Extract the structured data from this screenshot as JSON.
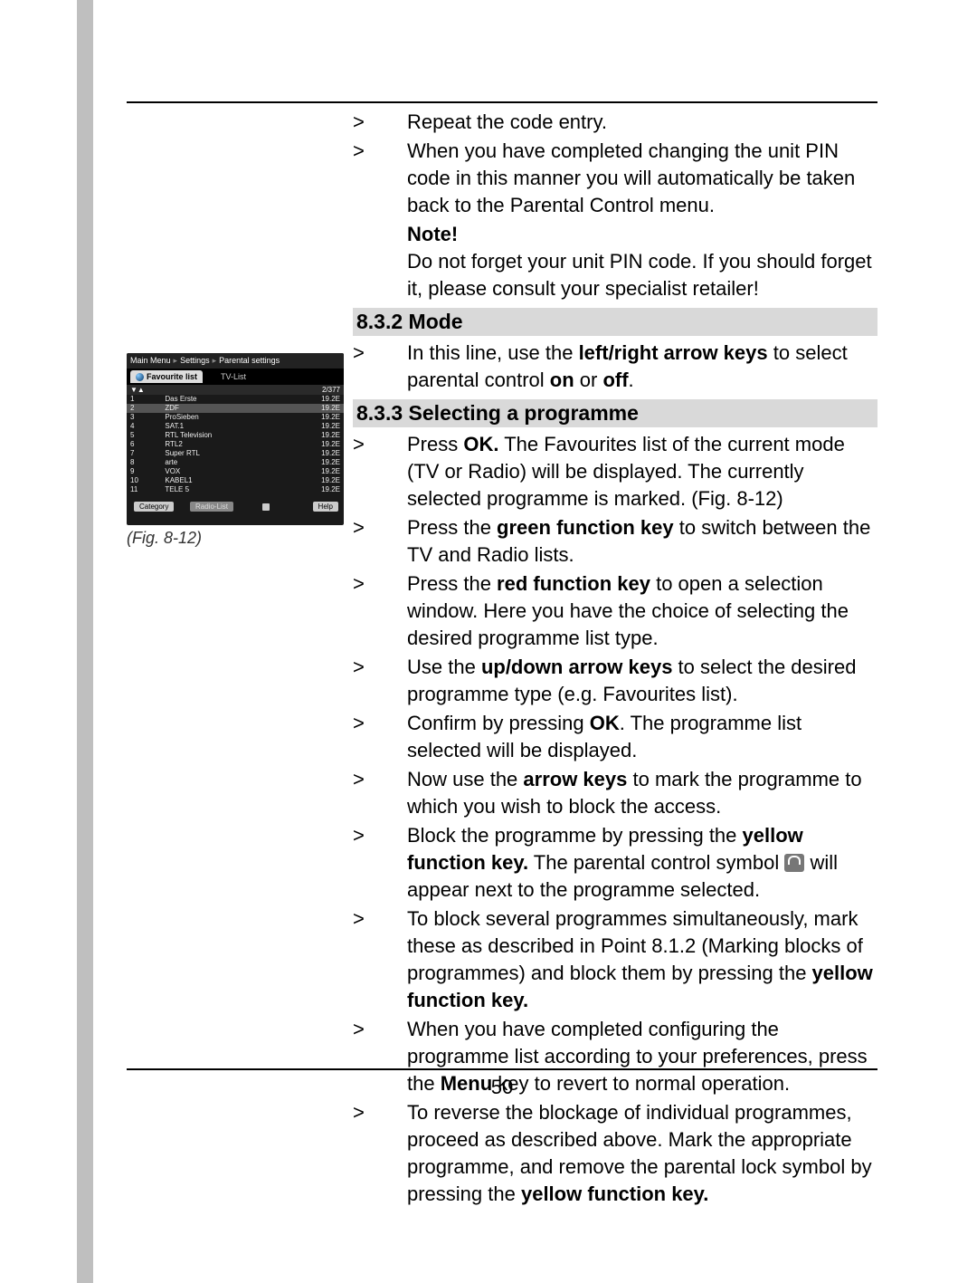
{
  "page_number": "50",
  "intro_steps": [
    "Repeat the code entry.",
    "When you have completed changing the unit PIN code in this manner you will automatically be taken back to the Parental Control menu."
  ],
  "note_label": "Note!",
  "note_text": "Do not forget your unit PIN code. If you should forget it, please consult your specialist retailer!",
  "sect_mode": "8.3.2 Mode",
  "mode_step_pre": "In this line, use the ",
  "mode_step_bold1": "left/right arrow keys",
  "mode_step_mid": " to select parental control ",
  "mode_step_bold2": "on",
  "mode_step_or": " or ",
  "mode_step_bold3": "off",
  "mode_step_end": ".",
  "sect_prog": "8.3.3 Selecting a programme",
  "prog": {
    "s1a": "Press ",
    "s1b": "OK.",
    "s1c": " The Favourites list of the current mode (TV or Radio) will be displayed. The currently selected programme is marked. (Fig. 8-12)",
    "s2a": "Press the ",
    "s2b": "green function key",
    "s2c": " to switch between the TV and Radio lists.",
    "s3a": "Press the ",
    "s3b": "red function key",
    "s3c": " to open a selection window. Here you have the choice of selecting the desired programme list type.",
    "s4a": "Use the ",
    "s4b": "up/down arrow keys",
    "s4c": " to select the desired programme type (e.g. Favourites list).",
    "s5a": "Confirm by pressing ",
    "s5b": "OK",
    "s5c": ". The programme list selected will be displayed.",
    "s6a": "Now use the ",
    "s6b": "arrow keys",
    "s6c": " to mark the programme to which you wish to block the access.",
    "s7a": "Block the programme by pressing the ",
    "s7b": "yellow function key.",
    "s7c": " The parental control symbol ",
    "s7d": " will appear next to the programme selected.",
    "s8a": "To block several programmes simultaneously, mark these as described in Point 8.1.2 (Marking blocks of programmes) and block them by pressing the ",
    "s8b": "yellow function key.",
    "s9a": "When you have completed configuring the programme list according to your preferences, press the ",
    "s9b": "Menu",
    "s9c": " key to revert to normal operation.",
    "s10a": "To reverse the blockage of individual programmes, proceed as described above. Mark the appropriate programme, and remove the parental lock symbol by pressing the ",
    "s10b": "yellow function key."
  },
  "fig_caption": "(Fig. 8-12)",
  "shot": {
    "crumb1": "Main Menu",
    "crumb2": "Settings",
    "crumb3": "Parental settings",
    "tab1": "Favourite list",
    "tab2": "TV-List",
    "counter": "2/377",
    "sort": "▼▲",
    "rows": [
      {
        "n": "1",
        "name": "Das Erste",
        "v": "19.2E"
      },
      {
        "n": "2",
        "name": "ZDF",
        "v": "19.2E"
      },
      {
        "n": "3",
        "name": "ProSieben",
        "v": "19.2E"
      },
      {
        "n": "4",
        "name": "SAT.1",
        "v": "19.2E"
      },
      {
        "n": "5",
        "name": "RTL Television",
        "v": "19.2E"
      },
      {
        "n": "6",
        "name": "RTL2",
        "v": "19.2E"
      },
      {
        "n": "7",
        "name": "Super RTL",
        "v": "19.2E"
      },
      {
        "n": "8",
        "name": "arte",
        "v": "19.2E"
      },
      {
        "n": "9",
        "name": "VOX",
        "v": "19.2E"
      },
      {
        "n": "10",
        "name": "KABEL1",
        "v": "19.2E"
      },
      {
        "n": "11",
        "name": "TELE 5",
        "v": "19.2E"
      }
    ],
    "btn_cat": "Category",
    "btn_radio": "Radio-List",
    "btn_help": "Help"
  }
}
